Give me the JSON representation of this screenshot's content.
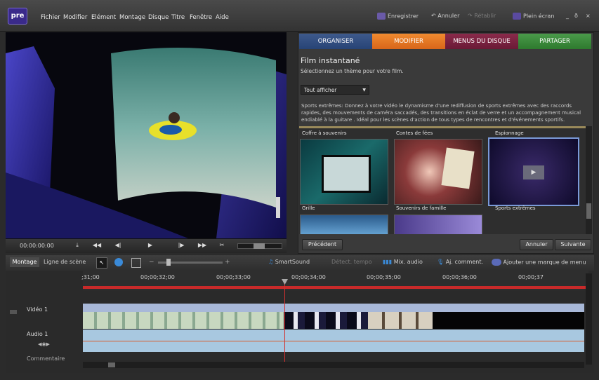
{
  "app": {
    "logo": "pre"
  },
  "menu": [
    "Fichier",
    "Modifier",
    "Elément",
    "Montage",
    "Disque",
    "Titre",
    "Fenêtre",
    "Aide"
  ],
  "toolbar": {
    "save": "Enregistrer",
    "undo": "Annuler",
    "redo": "Rétablir",
    "fullscreen": "Plein écran"
  },
  "window": {
    "min": "_",
    "restore": "ð",
    "close": "×"
  },
  "transport": {
    "timecode": "00:00:00:00"
  },
  "tabs": [
    "ORGANISER",
    "MODIFIER",
    "MENUS DU DISQUE",
    "PARTAGER"
  ],
  "panel": {
    "title": "Film instantané",
    "subtitle": "Sélectionnez un thème pour votre film.",
    "filter": "Tout afficher",
    "description": "Sports extrêmes: Donnez à votre vidéo le dynamisme d'une rediffusion de sports extrêmes avec des raccords rapides, des mouvements de caméra saccadés, des transitions en éclat de verre et un accompagnement musical endiablé à la guitare . Idéal pour les scènes d'action de tous types de rencontres et d'événements sportifs.",
    "top_labels": [
      "Coffre à souvenirs",
      "Contes de fées",
      "Espionnage"
    ],
    "themes": [
      "Grille",
      "Souvenirs de famille",
      "Sports extrêmes"
    ],
    "prev": "Précédent",
    "cancel": "Annuler",
    "next": "Suivante"
  },
  "timeline": {
    "view_montage": "Montage",
    "view_scene": "Ligne de scène",
    "smartsound": "SmartSound",
    "detect": "Détect. tempo",
    "mix": "Mix. audio",
    "comment": "Aj. comment.",
    "marker": "Ajouter une marque de menu",
    "ruler": [
      ";31;00",
      "00;00;32;00",
      "00;00;33;00",
      "00;00;34;00",
      "00;00;35;00",
      "00;00;36;00",
      "00;00;37"
    ],
    "tracks": [
      "Vidéo 1",
      "Audio 1",
      "Commentaire"
    ]
  },
  "colors": {
    "organiser": "#274476",
    "modifier": "#e0701f",
    "menus": "#7a1f40",
    "partager": "#3a8a3a",
    "playhead": "#d23030"
  }
}
